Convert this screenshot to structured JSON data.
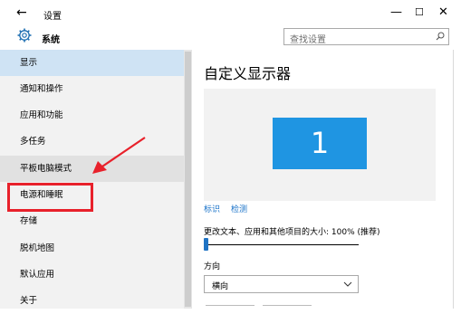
{
  "window": {
    "title": "设置",
    "back_glyph": "←",
    "minimize_glyph": "—",
    "maximize_glyph": "☐",
    "close_glyph": "✕"
  },
  "header": {
    "app_name": "系统",
    "icon": "gear-icon"
  },
  "search": {
    "placeholder": "查找设置",
    "icon": "search-icon"
  },
  "sidebar": {
    "items": [
      {
        "label": "显示",
        "state": "selected"
      },
      {
        "label": "通知和操作",
        "state": "normal"
      },
      {
        "label": "应用和功能",
        "state": "normal"
      },
      {
        "label": "多任务",
        "state": "normal"
      },
      {
        "label": "平板电脑模式",
        "state": "hover"
      },
      {
        "label": "电源和睡眠",
        "state": "highlighted"
      },
      {
        "label": "存储",
        "state": "normal"
      },
      {
        "label": "脱机地图",
        "state": "normal"
      },
      {
        "label": "默认应用",
        "state": "normal"
      },
      {
        "label": "关于",
        "state": "normal"
      }
    ]
  },
  "main": {
    "heading": "自定义显示器",
    "monitor_number": "1",
    "identify_link": "标识",
    "detect_link": "检测",
    "scale_label": "更改文本、应用和其他项目的大小: 100% (推荐)",
    "scale_level_fraction": 0.0,
    "orientation_label": "方向",
    "orientation_value": "横向"
  },
  "annotation": {
    "arrow_color": "#e8212b",
    "box_color": "#e8212b"
  },
  "colors": {
    "accent": "#1f95e2",
    "selected_bg": "#cfe3f4",
    "link": "#1a73c9"
  }
}
